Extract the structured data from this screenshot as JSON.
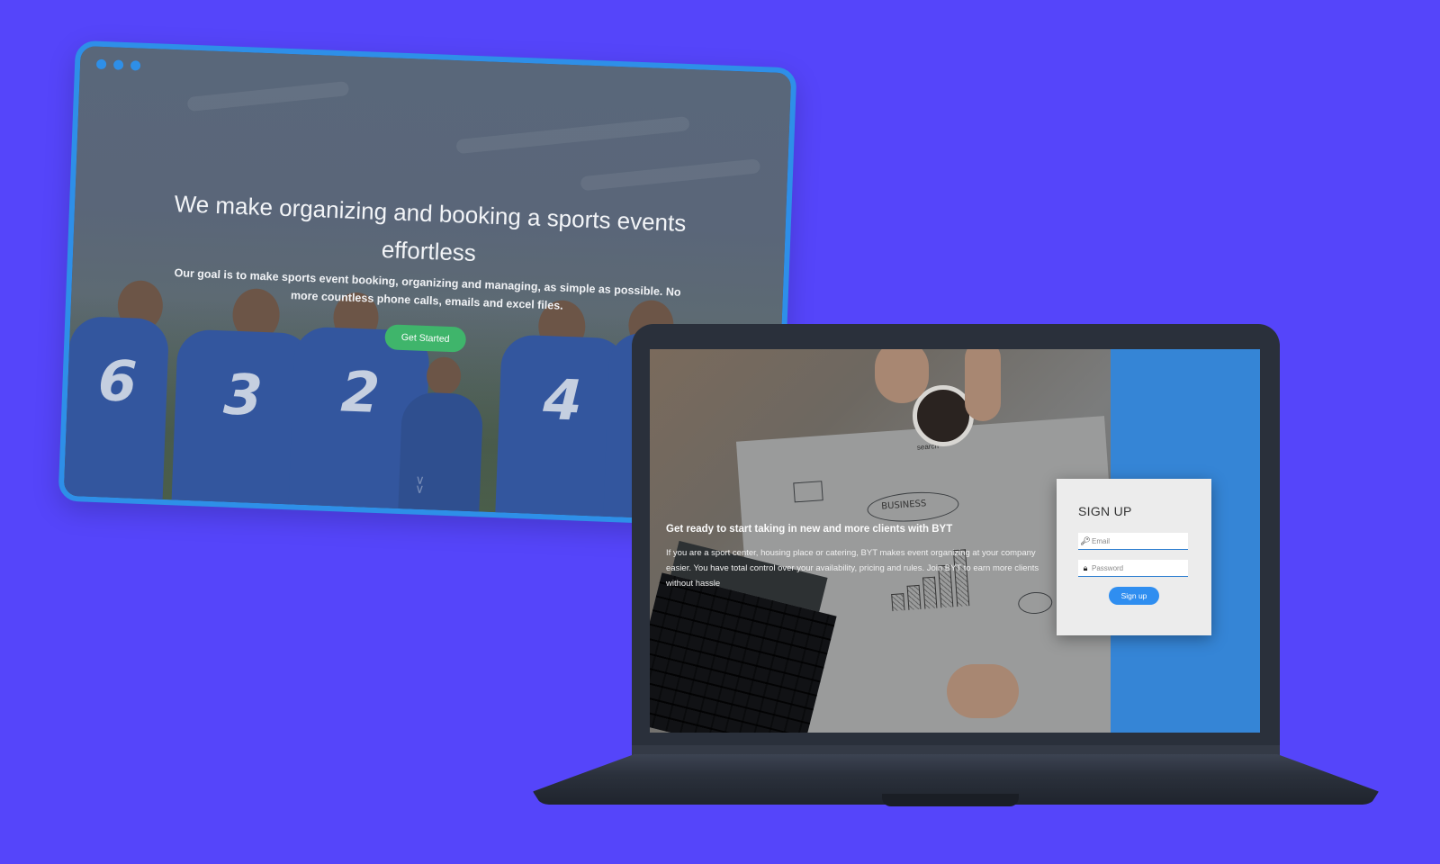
{
  "background_color": "#5545fa",
  "browser": {
    "window_dots": [
      "dot",
      "dot",
      "dot"
    ],
    "hero": {
      "title": "We make organizing and booking a sports events effortless",
      "subtitle": "Our goal is to make sports event booking, organizing and managing, as simple as possible. No more countless phone calls, emails and excel files.",
      "cta_label": "Get Started",
      "cta_color": "#3fb56b",
      "scroll_icon": "double-chevron-down"
    },
    "jersey_numbers": [
      "6",
      "3",
      "2",
      "4"
    ],
    "accent_color": "#2e8fe8"
  },
  "laptop": {
    "screen": {
      "heading": "Get ready to start taking in new and more clients with BYT",
      "body": "If you are a sport center, housing place or catering, BYT makes event organizing at your company easier. You have total control over your availability, pricing and rules. Join BYT to earn more clients without hassle",
      "sketch_word": "BUSINESS",
      "sketch_search": "search",
      "side_color": "#3585d6"
    },
    "signup": {
      "title": "SIGN UP",
      "email_placeholder": "Email",
      "email_icon": "key-icon",
      "password_placeholder": "Password",
      "password_icon": "lock-icon",
      "button_label": "Sign up",
      "button_color": "#2f8ef0"
    }
  }
}
